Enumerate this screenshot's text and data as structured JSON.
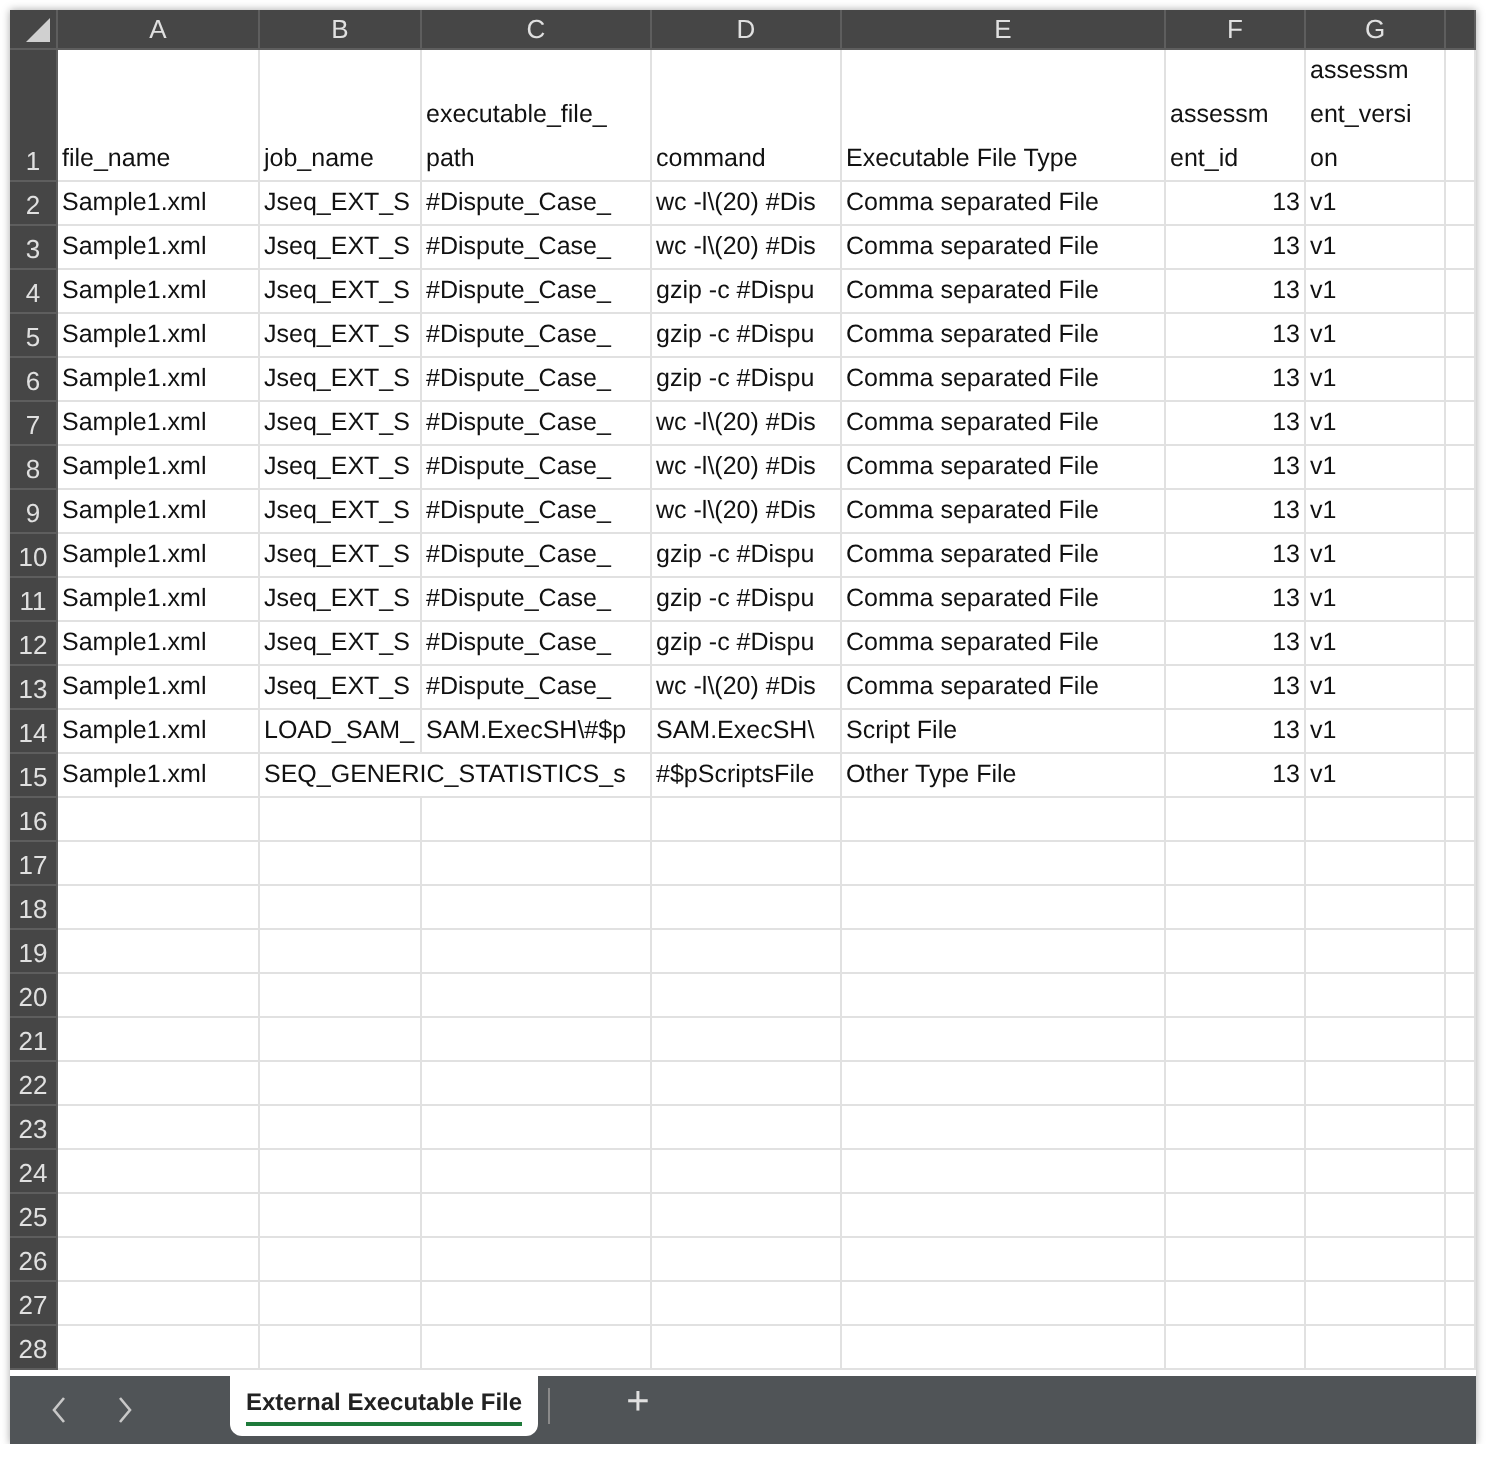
{
  "columns": [
    {
      "label": "A",
      "numeric": false
    },
    {
      "label": "B",
      "numeric": false
    },
    {
      "label": "C",
      "numeric": false
    },
    {
      "label": "D",
      "numeric": false
    },
    {
      "label": "E",
      "numeric": false
    },
    {
      "label": "F",
      "numeric": true
    },
    {
      "label": "G",
      "numeric": false
    }
  ],
  "rows": [
    {
      "number": "1",
      "cells": [
        "file_name",
        "job_name",
        "executable_file_\npath",
        "command",
        "Executable File Type",
        "assessm\nent_id",
        "assessm\nent_versi\non"
      ]
    },
    {
      "number": "2",
      "cells": [
        "Sample1.xml",
        "Jseq_EXT_S",
        "#Dispute_Case_",
        "wc -l\\(20) #Dis",
        "Comma separated File",
        "13",
        "v1"
      ]
    },
    {
      "number": "3",
      "cells": [
        "Sample1.xml",
        "Jseq_EXT_S",
        "#Dispute_Case_",
        "wc -l\\(20) #Dis",
        "Comma separated File",
        "13",
        "v1"
      ]
    },
    {
      "number": "4",
      "cells": [
        "Sample1.xml",
        "Jseq_EXT_S",
        "#Dispute_Case_",
        "gzip -c #Dispu",
        "Comma separated File",
        "13",
        "v1"
      ]
    },
    {
      "number": "5",
      "cells": [
        "Sample1.xml",
        "Jseq_EXT_S",
        "#Dispute_Case_",
        "gzip -c #Dispu",
        "Comma separated File",
        "13",
        "v1"
      ]
    },
    {
      "number": "6",
      "cells": [
        "Sample1.xml",
        "Jseq_EXT_S",
        "#Dispute_Case_",
        "gzip -c #Dispu",
        "Comma separated File",
        "13",
        "v1"
      ]
    },
    {
      "number": "7",
      "cells": [
        "Sample1.xml",
        "Jseq_EXT_S",
        "#Dispute_Case_",
        "wc -l\\(20) #Dis",
        "Comma separated File",
        "13",
        "v1"
      ]
    },
    {
      "number": "8",
      "cells": [
        "Sample1.xml",
        "Jseq_EXT_S",
        "#Dispute_Case_",
        "wc -l\\(20) #Dis",
        "Comma separated File",
        "13",
        "v1"
      ]
    },
    {
      "number": "9",
      "cells": [
        "Sample1.xml",
        "Jseq_EXT_S",
        "#Dispute_Case_",
        "wc -l\\(20) #Dis",
        "Comma separated File",
        "13",
        "v1"
      ]
    },
    {
      "number": "10",
      "cells": [
        "Sample1.xml",
        "Jseq_EXT_S",
        "#Dispute_Case_",
        "gzip -c #Dispu",
        "Comma separated File",
        "13",
        "v1"
      ]
    },
    {
      "number": "11",
      "cells": [
        "Sample1.xml",
        "Jseq_EXT_S",
        "#Dispute_Case_",
        "gzip -c #Dispu",
        "Comma separated File",
        "13",
        "v1"
      ]
    },
    {
      "number": "12",
      "cells": [
        "Sample1.xml",
        "Jseq_EXT_S",
        "#Dispute_Case_",
        "gzip -c #Dispu",
        "Comma separated File",
        "13",
        "v1"
      ]
    },
    {
      "number": "13",
      "cells": [
        "Sample1.xml",
        "Jseq_EXT_S",
        "#Dispute_Case_",
        "wc -l\\(20) #Dis",
        "Comma separated File",
        "13",
        "v1"
      ]
    },
    {
      "number": "14",
      "cells": [
        "Sample1.xml",
        "LOAD_SAM_",
        "SAM.ExecSH\\#$p",
        "SAM.ExecSH\\",
        "Script File",
        "13",
        "v1"
      ]
    },
    {
      "number": "15",
      "cells": [
        "Sample1.xml",
        "SEQ_GENERIC_STATISTICS_s",
        null,
        "#$pScriptsFile",
        "Other Type File",
        "13",
        "v1"
      ]
    },
    {
      "number": "16"
    },
    {
      "number": "17"
    },
    {
      "number": "18"
    },
    {
      "number": "19"
    },
    {
      "number": "20"
    },
    {
      "number": "21"
    },
    {
      "number": "22"
    },
    {
      "number": "23"
    },
    {
      "number": "24"
    },
    {
      "number": "25"
    },
    {
      "number": "26"
    },
    {
      "number": "27"
    },
    {
      "number": "28"
    }
  ],
  "sheet_tabs": [
    {
      "label": "External Executable File",
      "selected": true
    }
  ],
  "add_sheet_button": "+"
}
